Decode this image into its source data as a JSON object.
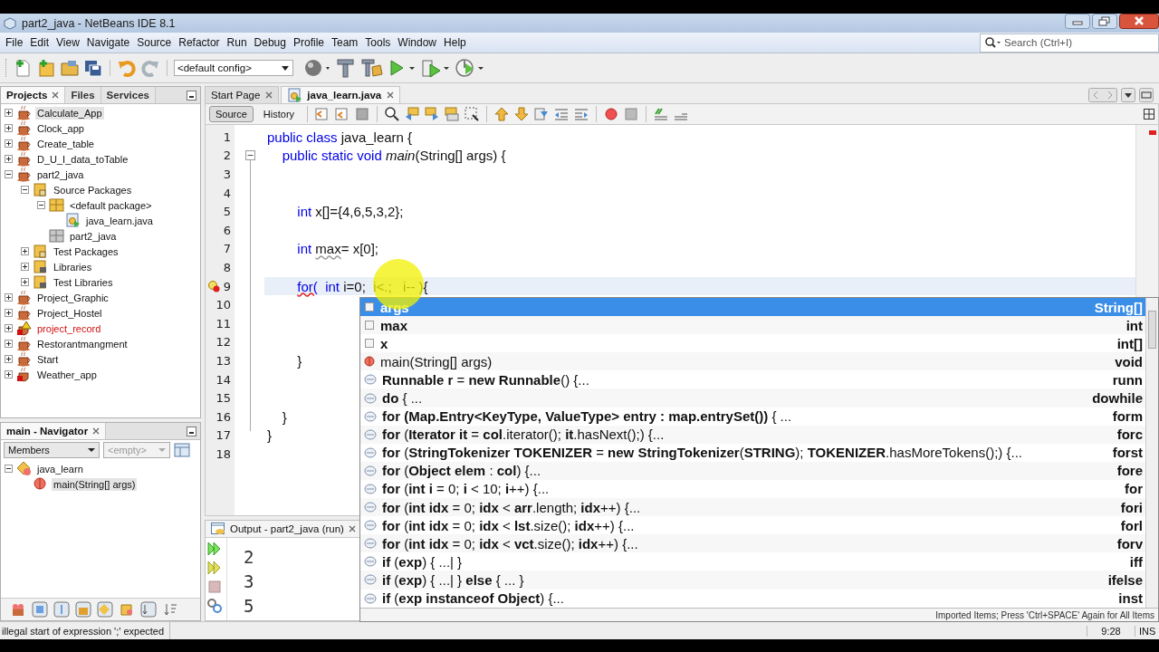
{
  "window": {
    "title": "part2_java - NetBeans IDE 8.1"
  },
  "menu": [
    "File",
    "Edit",
    "View",
    "Navigate",
    "Source",
    "Refactor",
    "Run",
    "Debug",
    "Profile",
    "Team",
    "Tools",
    "Window",
    "Help"
  ],
  "search": {
    "placeholder": "Search (Ctrl+I)"
  },
  "toolbar": {
    "config": "<default config>"
  },
  "left_tabs": [
    {
      "label": "Projects",
      "selected": true,
      "closable": true
    },
    {
      "label": "Files",
      "selected": false,
      "closable": false
    },
    {
      "label": "Services",
      "selected": false,
      "closable": false
    }
  ],
  "projects": [
    {
      "label": "Calculate_App",
      "kind": "project",
      "expanded": false,
      "selected": true
    },
    {
      "label": "Clock_app",
      "kind": "project",
      "expanded": false,
      "selected": false
    },
    {
      "label": "Create_table",
      "kind": "project",
      "expanded": false,
      "selected": false
    },
    {
      "label": "D_U_I_data_toTable",
      "kind": "project",
      "expanded": false,
      "selected": false
    },
    {
      "label": "part2_java",
      "kind": "project",
      "expanded": true,
      "selected": false,
      "children": [
        {
          "label": "Source Packages",
          "kind": "source-folder",
          "expanded": true,
          "selected": false,
          "children": [
            {
              "label": "<default package>",
              "kind": "package",
              "expanded": true,
              "selected": false,
              "children": [
                {
                  "label": "java_learn.java",
                  "kind": "java-file",
                  "selected": false
                }
              ]
            },
            {
              "label": "part2_java",
              "kind": "empty-package",
              "selected": false
            }
          ]
        },
        {
          "label": "Test Packages",
          "kind": "source-folder",
          "expanded": false,
          "selected": false
        },
        {
          "label": "Libraries",
          "kind": "library",
          "expanded": false,
          "selected": false
        },
        {
          "label": "Test Libraries",
          "kind": "library",
          "expanded": false,
          "selected": false
        }
      ]
    },
    {
      "label": "Project_Graphic",
      "kind": "project",
      "expanded": false,
      "selected": false
    },
    {
      "label": "Project_Hostel",
      "kind": "project",
      "expanded": false,
      "selected": false
    },
    {
      "label": "project_record",
      "kind": "project-error",
      "expanded": false,
      "selected": false
    },
    {
      "label": "Restorantmangment",
      "kind": "project",
      "expanded": false,
      "selected": false
    },
    {
      "label": "Start",
      "kind": "project",
      "expanded": false,
      "selected": false
    },
    {
      "label": "Weather_app",
      "kind": "project-broken",
      "expanded": false,
      "selected": false
    }
  ],
  "navigator": {
    "title": "main - Navigator",
    "filter": "Members",
    "second_filter": "<empty>",
    "tree": [
      {
        "label": "java_learn",
        "kind": "class",
        "expanded": true,
        "selected": false,
        "children": [
          {
            "label": "main(String[] args)",
            "kind": "method",
            "selected": true
          }
        ]
      }
    ]
  },
  "editor_tabs": [
    {
      "label": "Start Page",
      "selected": false
    },
    {
      "label": "java_learn.java",
      "selected": true
    }
  ],
  "view_tabs": [
    {
      "label": "Source",
      "selected": true
    },
    {
      "label": "History",
      "selected": false
    }
  ],
  "code": [
    {
      "number": "1",
      "current": false,
      "segments": [
        {
          "text": "public class",
          "kind": "keyword"
        },
        {
          "text": " java_learn {",
          "kind": "plain"
        }
      ]
    },
    {
      "number": "2",
      "current": false,
      "fold": true,
      "segments": [
        {
          "text": "    public static void",
          "kind": "keyword"
        },
        {
          "text": " main",
          "kind": "method"
        },
        {
          "text": "(String[] args) {",
          "kind": "plain"
        }
      ]
    },
    {
      "number": "3",
      "current": false
    },
    {
      "number": "4",
      "current": false
    },
    {
      "number": "5",
      "current": false,
      "segments": [
        {
          "text": "        int",
          "kind": "keyword"
        },
        {
          "text": " x[]={4,6,5,3,2};",
          "kind": "plain"
        }
      ]
    },
    {
      "number": "6",
      "current": false
    },
    {
      "number": "7",
      "current": false,
      "segments": [
        {
          "text": "        int ",
          "kind": "keyword"
        },
        {
          "text": "max",
          "kind": "warning-plain"
        },
        {
          "text": "= x[0];",
          "kind": "plain"
        }
      ]
    },
    {
      "number": "8",
      "current": false
    },
    {
      "number": "9",
      "current": true,
      "error_mark": true,
      "segments": [
        {
          "text": "        for(",
          "kind": "error-keyword"
        },
        {
          "text": "  int",
          "kind": "keyword"
        },
        {
          "text": " i=0;  i<.;   i-- ){",
          "kind": "plain"
        }
      ]
    },
    {
      "number": "10",
      "current": false
    },
    {
      "number": "11",
      "current": false
    },
    {
      "number": "12",
      "current": false
    },
    {
      "number": "13",
      "current": false,
      "segments": [
        {
          "text": "        }",
          "kind": "plain"
        }
      ]
    },
    {
      "number": "14",
      "current": false
    },
    {
      "number": "15",
      "current": false
    },
    {
      "number": "16",
      "current": false,
      "segments": [
        {
          "text": "    }",
          "kind": "plain"
        }
      ]
    },
    {
      "number": "17",
      "current": false,
      "segments": [
        {
          "text": "}",
          "kind": "plain"
        }
      ]
    },
    {
      "number": "18",
      "current": false
    }
  ],
  "output": {
    "title": "Output - part2_java (run)",
    "lines": [
      "2",
      "3",
      "5"
    ]
  },
  "completion": {
    "items": [
      {
        "kind": "field",
        "text": "**args**",
        "type": "String[]",
        "selected": true
      },
      {
        "kind": "field",
        "text": "**max**",
        "type": "int",
        "selected": false
      },
      {
        "kind": "field",
        "text": "**x**",
        "type": "int[]",
        "selected": false
      },
      {
        "kind": "method",
        "text": "main(String[] args)",
        "type": "void",
        "selected": false
      },
      {
        "kind": "template",
        "text": "**Runnable r** = **new Runnable**() {...",
        "type": "runn",
        "selected": false
      },
      {
        "kind": "template",
        "text": "**do** { ...",
        "type": "dowhile",
        "selected": false
      },
      {
        "kind": "template",
        "text": "**for (Map.Entry<KeyType, ValueType> entry : map.entrySet())** { ...",
        "type": "form",
        "selected": false
      },
      {
        "kind": "template",
        "text": "**for** (**Iterator it** = **col**.iterator(); **it**.hasNext();) {...",
        "type": "forc",
        "selected": false
      },
      {
        "kind": "template",
        "text": "**for** (**StringTokenizer TOKENIZER** = **new StringTokenizer**(**STRING**); **TOKENIZER**.hasMoreTokens();) {...",
        "type": "forst",
        "selected": false
      },
      {
        "kind": "template",
        "text": "**for** (**Object elem** : **col**) {...",
        "type": "fore",
        "selected": false
      },
      {
        "kind": "template",
        "text": "**for** (**int i** = 0; **i** < 10; **i**++) {...",
        "type": "for",
        "selected": false
      },
      {
        "kind": "template",
        "text": "**for** (**int idx** = 0; **idx** < **arr**.length; **idx**++) {...",
        "type": "fori",
        "selected": false
      },
      {
        "kind": "template",
        "text": "**for** (**int idx** = 0; **idx** < **lst**.size(); **idx**++) {...",
        "type": "forl",
        "selected": false
      },
      {
        "kind": "template",
        "text": "**for** (**int idx** = 0; **idx** < **vct**.size(); **idx**++) {...",
        "type": "forv",
        "selected": false
      },
      {
        "kind": "template",
        "text": "**if** (**exp**) { ...| }",
        "type": "iff",
        "selected": false
      },
      {
        "kind": "template",
        "text": "**if** (**exp**) { ...| } **else** { ... }",
        "type": "ifelse",
        "selected": false
      },
      {
        "kind": "template",
        "text": "**if** (**exp instanceof Object**) {...",
        "type": "inst",
        "selected": false
      }
    ],
    "footer": "Imported Items; Press 'Ctrl+SPACE' Again for All Items"
  },
  "status_bar": {
    "message": "illegal start of expression  ';' expected",
    "position": "9:28",
    "mode": "INS"
  }
}
